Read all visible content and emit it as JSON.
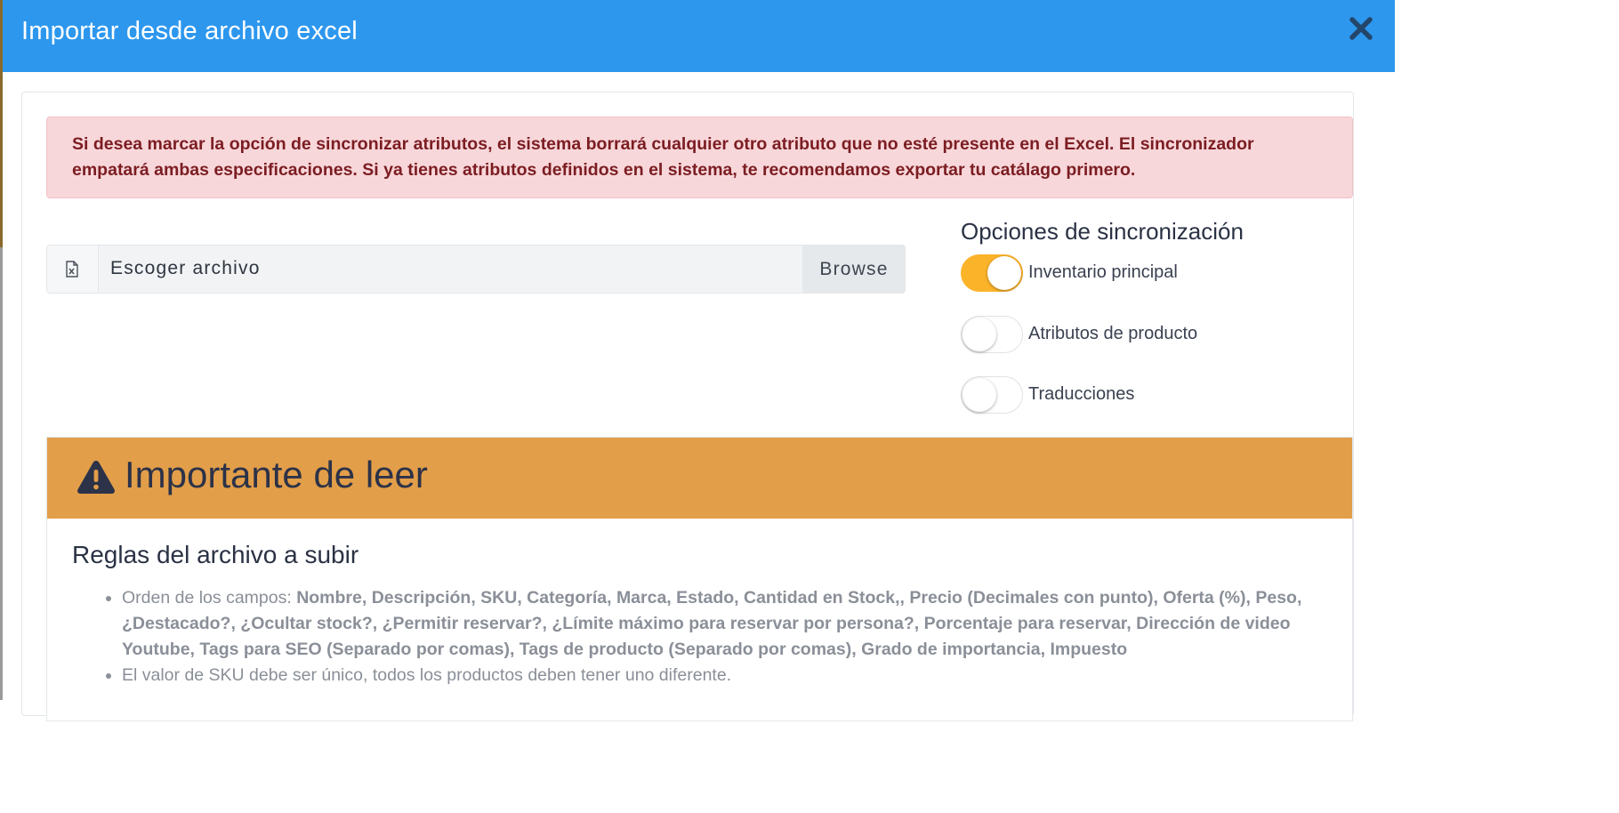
{
  "modal": {
    "title": "Importar desde archivo excel",
    "close_icon": "close-icon",
    "header_color": "#2d97ee"
  },
  "alert": {
    "text": "Si desea marcar la opción de sincronizar atributos, el sistema borrará cualquier otro atributo que no esté presente en el Excel. El sincronizador empatará ambas especificaciones. Si ya tienes atributos definidos en el sistema, te recomendamos exportar tu catálago primero.",
    "bg_color": "#f8d7da",
    "text_color": "#7b1d22"
  },
  "file_input": {
    "icon": "file-excel-icon",
    "label": "Escoger archivo",
    "browse_label": "Browse"
  },
  "sync": {
    "title": "Opciones de sincronización",
    "options": [
      {
        "label": "Inventario principal",
        "checked": true
      },
      {
        "label": "Atributos de producto",
        "checked": false
      },
      {
        "label": "Traducciones",
        "checked": false
      }
    ],
    "on_color": "#fbb32a"
  },
  "important": {
    "icon": "warning-triangle-icon",
    "title": "Importante de leer",
    "header_color": "#e29e49",
    "rules_title": "Reglas del archivo a subir",
    "rule1_prefix": "Orden de los campos: ",
    "rule1_fields": "Nombre, Descripción, SKU, Categoría, Marca, Estado, Cantidad en Stock,, Precio (Decimales con punto), Oferta (%), Peso, ¿Destacado?, ¿Ocultar stock?, ¿Permitir reservar?, ¿Límite máximo para reservar por persona?, Porcentaje para reservar, Dirección de video Youtube, Tags para SEO (Separado por comas), Tags de producto (Separado por comas), Grado de importancia, Impuesto",
    "rule2": "El valor de SKU debe ser único, todos los productos deben tener uno diferente."
  }
}
